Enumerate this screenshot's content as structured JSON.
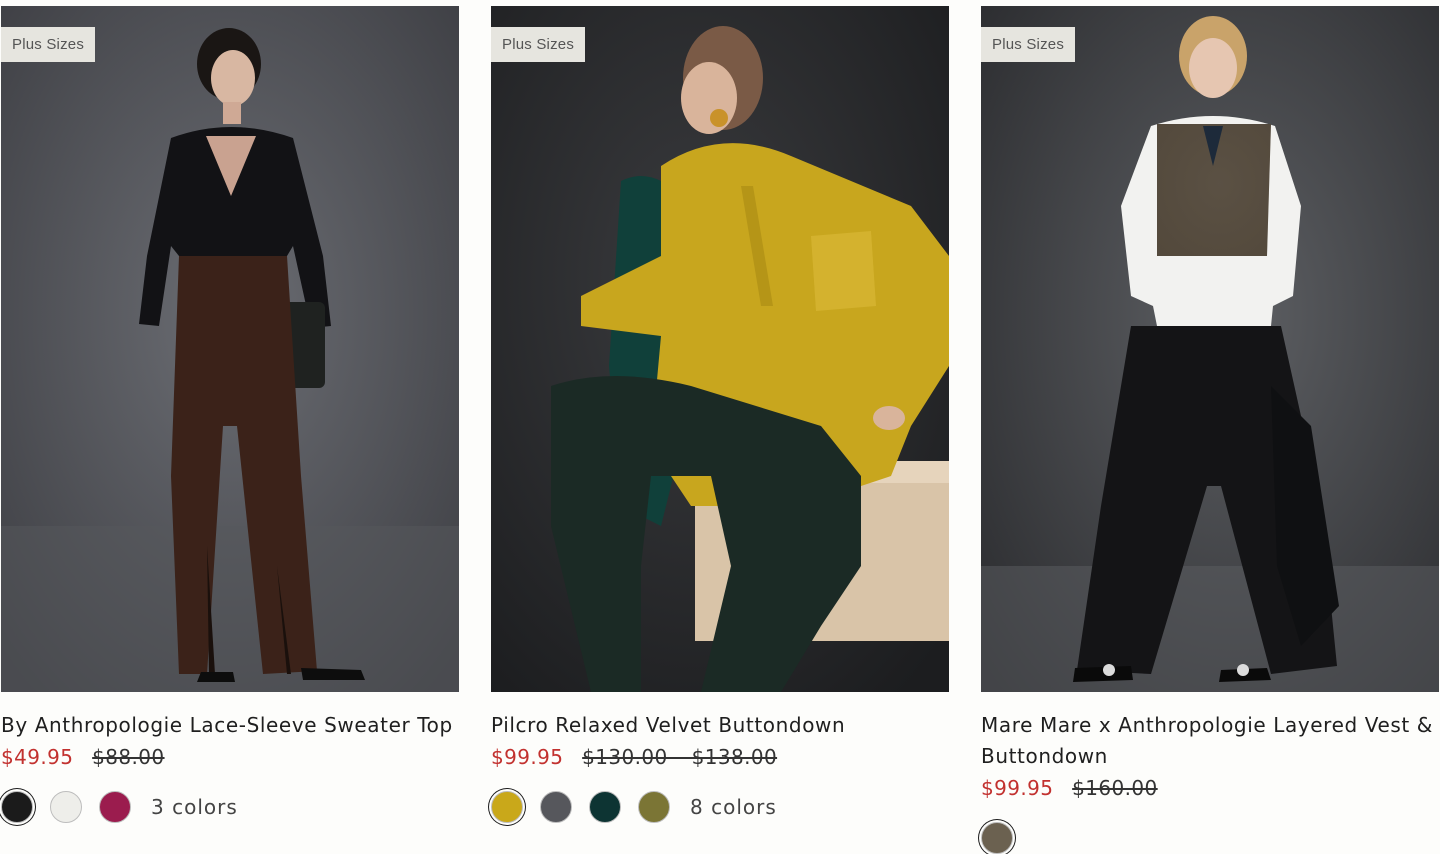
{
  "products": [
    {
      "badge": "Plus Sizes",
      "image_alt": "model wearing black lace-sleeve wrap sweater and brown wide-leg trousers",
      "title": "By Anthropologie Lace-Sleeve Sweater Top",
      "sale_price": "$49.95",
      "original_price": "$88.00",
      "swatches": [
        "#1b1b1b",
        "#eeeeea",
        "#9b1c4e"
      ],
      "colors_label": "3 colors"
    },
    {
      "badge": "Plus Sizes",
      "image_alt": "model seated on a wooden block wearing chartreuse velvet buttondown shirt and dark green trousers",
      "title": "Pilcro Relaxed Velvet Buttondown",
      "sale_price": "$99.95",
      "original_price": "$130.00 – $138.00",
      "swatches": [
        "#c9a81a",
        "#56575c",
        "#0d3433",
        "#7b7535"
      ],
      "colors_label": "8 colors"
    },
    {
      "badge": "Plus Sizes",
      "image_alt": "model wearing tweed cropped vest over white buttondown with black wide-leg trousers",
      "title": "Mare Mare x Anthropologie Layered Vest & Buttondown",
      "sale_price": "$99.95",
      "original_price": "$160.00"
    }
  ]
}
